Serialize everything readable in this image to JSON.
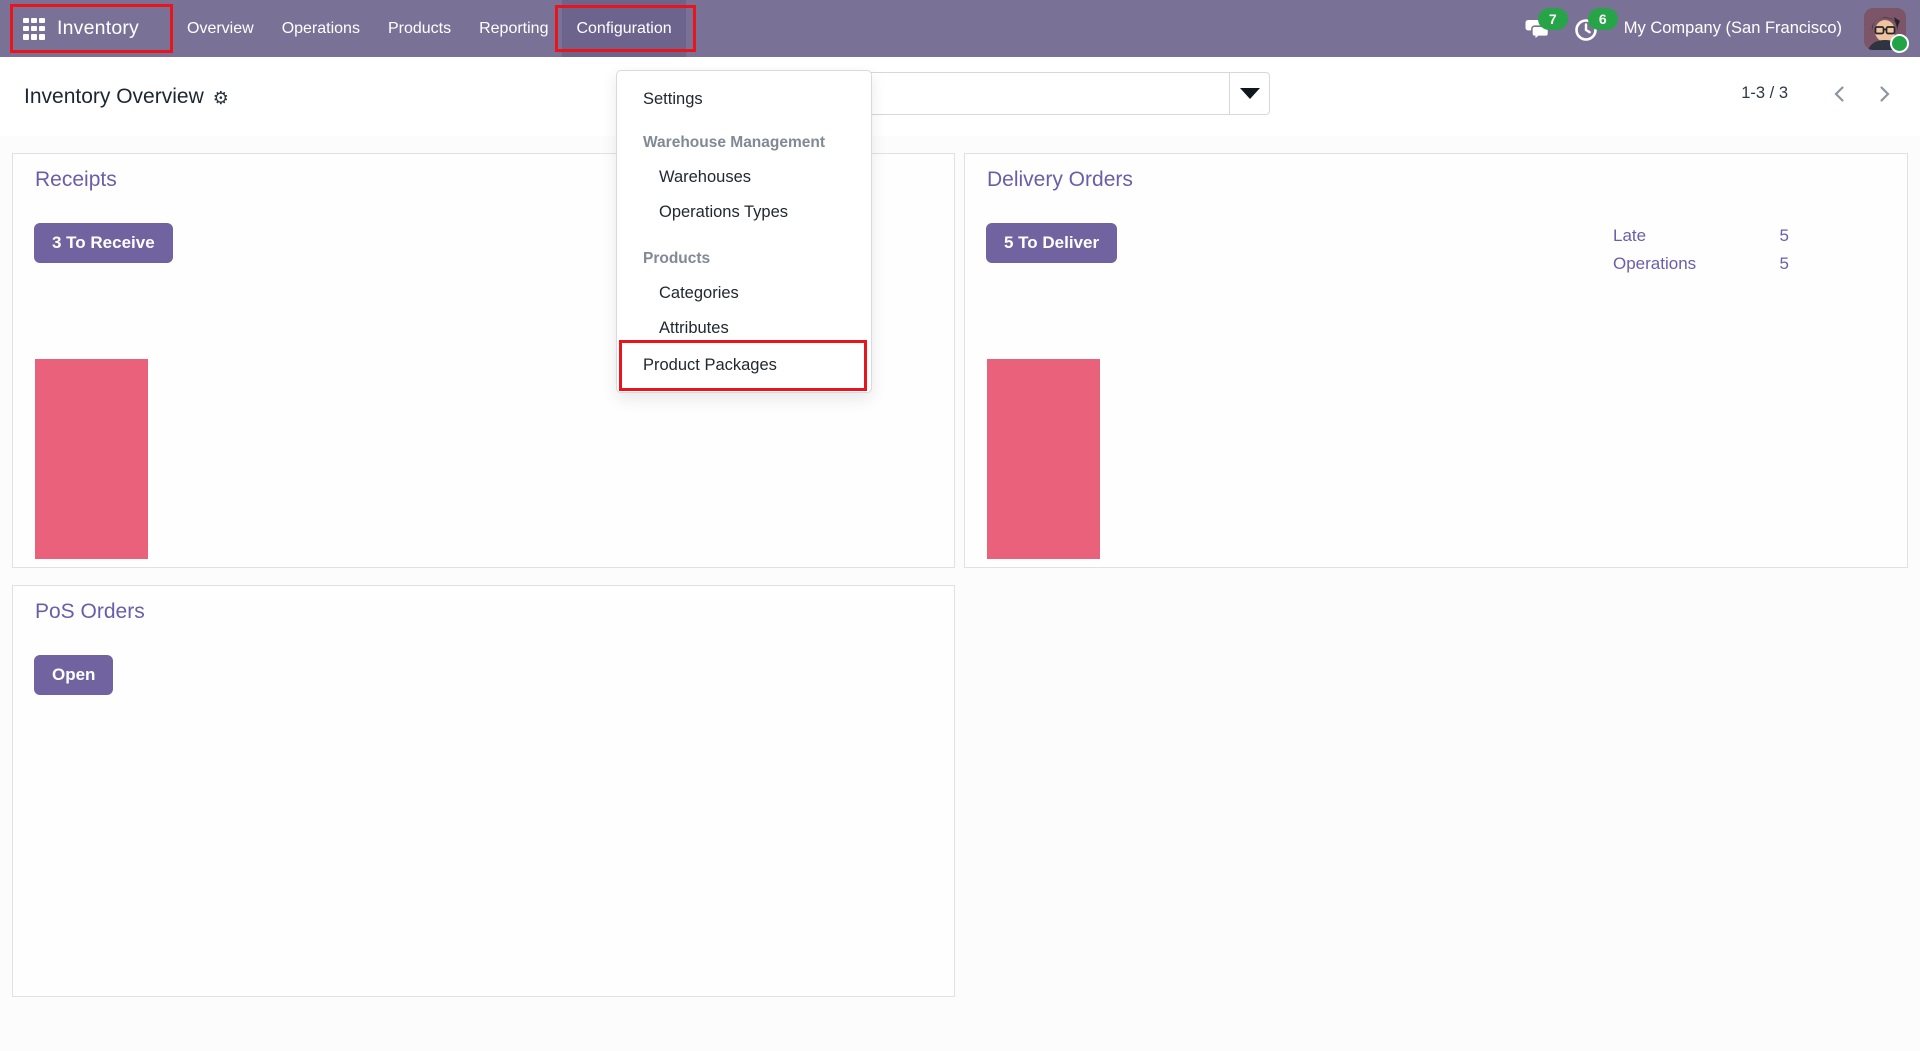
{
  "appbar": {
    "brand": "Inventory",
    "menu": [
      {
        "label": "Overview"
      },
      {
        "label": "Operations"
      },
      {
        "label": "Products"
      },
      {
        "label": "Reporting"
      },
      {
        "label": "Configuration"
      }
    ],
    "systray": {
      "messages_count": "7",
      "activities_count": "6",
      "company": "My Company (San Francisco)"
    },
    "colors": {
      "background": "#7a7296",
      "active_item_background": "#6c648c",
      "badge_green": "#27a348"
    }
  },
  "control_panel": {
    "title": "Inventory Overview",
    "gear_icon": "⚙",
    "search": {
      "value": ""
    },
    "pager": {
      "range": "1-3 / 3"
    }
  },
  "config_menu": {
    "settings": {
      "label": "Settings"
    },
    "sections": [
      {
        "header": "Warehouse Management",
        "items": [
          {
            "label": "Warehouses"
          },
          {
            "label": "Operations Types"
          }
        ]
      },
      {
        "header": "Products",
        "items": [
          {
            "label": "Categories"
          },
          {
            "label": "Attributes"
          }
        ]
      }
    ],
    "highlighted": {
      "label": "Product Packages"
    }
  },
  "dashboard": {
    "receipts": {
      "title": "Receipts",
      "button_label": "3 To Receive",
      "graph_bar_color": "#e9617a"
    },
    "delivery": {
      "title": "Delivery Orders",
      "button_label": "5 To Deliver",
      "stats": [
        {
          "label": "Late",
          "value": "5"
        },
        {
          "label": "Operations",
          "value": "5"
        }
      ],
      "graph_bar_color": "#e9617a"
    },
    "pos": {
      "title": "PoS Orders",
      "button_label": "Open"
    }
  },
  "annotation": {
    "color": "#e9151d"
  }
}
